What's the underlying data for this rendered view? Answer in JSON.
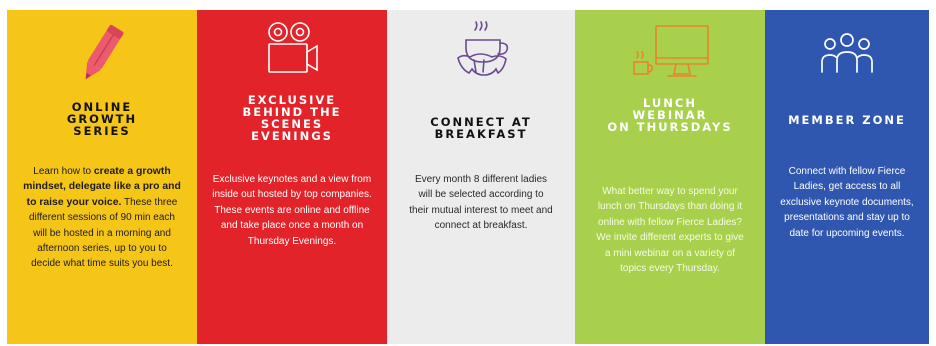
{
  "panels": [
    {
      "icon": "pencil-icon",
      "title": "ONLINE\nGROWTH\nSERIES",
      "body": {
        "t1": "Learn how to ",
        "b1": "create a growth mindset, delegate like a pro and to raise your voice.",
        "t2": " These three different sessions of 90 min each will be hosted in a morning and afternoon series, up to you to decide what time suits you best."
      }
    },
    {
      "icon": "movie-camera-icon",
      "title": "EXCLUSIVE\nBEHIND THE\nSCENES\nEVENINGS",
      "body": "Exclusive keynotes and a view from inside out hosted by top companies. These events are online and offline and take place once a month on Thursday Evenings."
    },
    {
      "icon": "coffee-croissant-icon",
      "title": "CONNECT AT\nBREAKFAST",
      "body": "Every month 8 different ladies will be selected according to their mutual interest to meet and connect at breakfast."
    },
    {
      "icon": "computer-coffee-icon",
      "title": "LUNCH\nWEBINAR\nON THURSDAYS",
      "body": "What better way to spend your lunch on Thursdays than doing it online with fellow Fierce Ladies? We invite different experts to give a mini webinar on a variety of topics every Thursday."
    },
    {
      "icon": "people-group-icon",
      "title": "MEMBER ZONE",
      "body": "Connect with fellow Fierce Ladies, get access to all exclusive keynote documents, presentations and stay up to date for upcoming events."
    }
  ],
  "colors": {
    "yellow": "#f5c518",
    "red": "#e3232a",
    "grey": "#ececec",
    "green": "#a8d04c",
    "blue": "#2f57b0",
    "pencil": "#ec5a6d",
    "purple": "#6a4b94",
    "orange": "#e8842b"
  }
}
